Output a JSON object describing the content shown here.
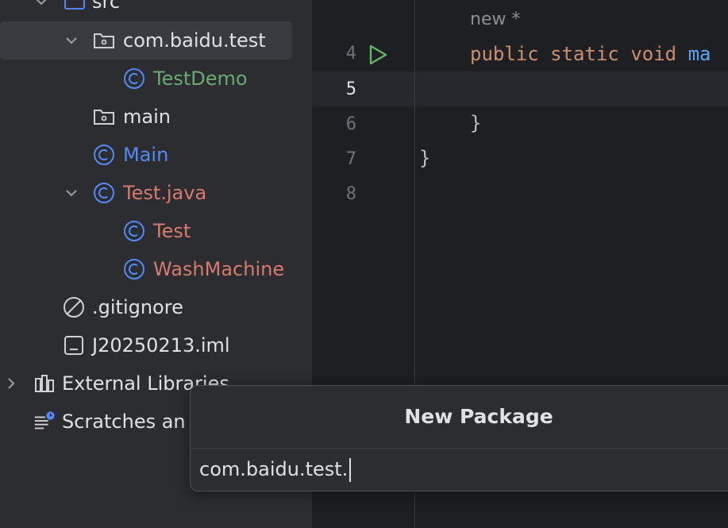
{
  "project_tree": {
    "items": [
      {
        "label": "src",
        "icon": "folder-icon"
      },
      {
        "label": "com.baidu.test",
        "icon": "package-icon"
      },
      {
        "label": "TestDemo",
        "icon": "class-icon"
      },
      {
        "label": "main",
        "icon": "package-icon"
      },
      {
        "label": "Main",
        "icon": "class-icon"
      },
      {
        "label": "Test.java",
        "icon": "class-icon"
      },
      {
        "label": "Test",
        "icon": "class-icon"
      },
      {
        "label": "WashMachine",
        "icon": "class-icon"
      },
      {
        "label": ".gitignore",
        "icon": "ignore-file-icon"
      },
      {
        "label": "J20250213.iml",
        "icon": "module-file-icon"
      },
      {
        "label": "External Libraries",
        "icon": "libraries-icon"
      },
      {
        "label": "Scratches an",
        "icon": "scratches-icon"
      }
    ]
  },
  "editor": {
    "line_numbers": [
      "4",
      "5",
      "6",
      "7",
      "8"
    ],
    "hint": "new *",
    "code": {
      "line4_kw1": "public",
      "line4_kw2": "static",
      "line4_kw3": "void",
      "line4_fn": "ma",
      "line6": "}",
      "line7": "}"
    }
  },
  "dialog": {
    "title": "New Package",
    "input_value": "com.baidu.test."
  },
  "colors": {
    "accent_blue": "#548af7",
    "green_text": "#6aab73",
    "keyword": "#cf8e6d"
  }
}
